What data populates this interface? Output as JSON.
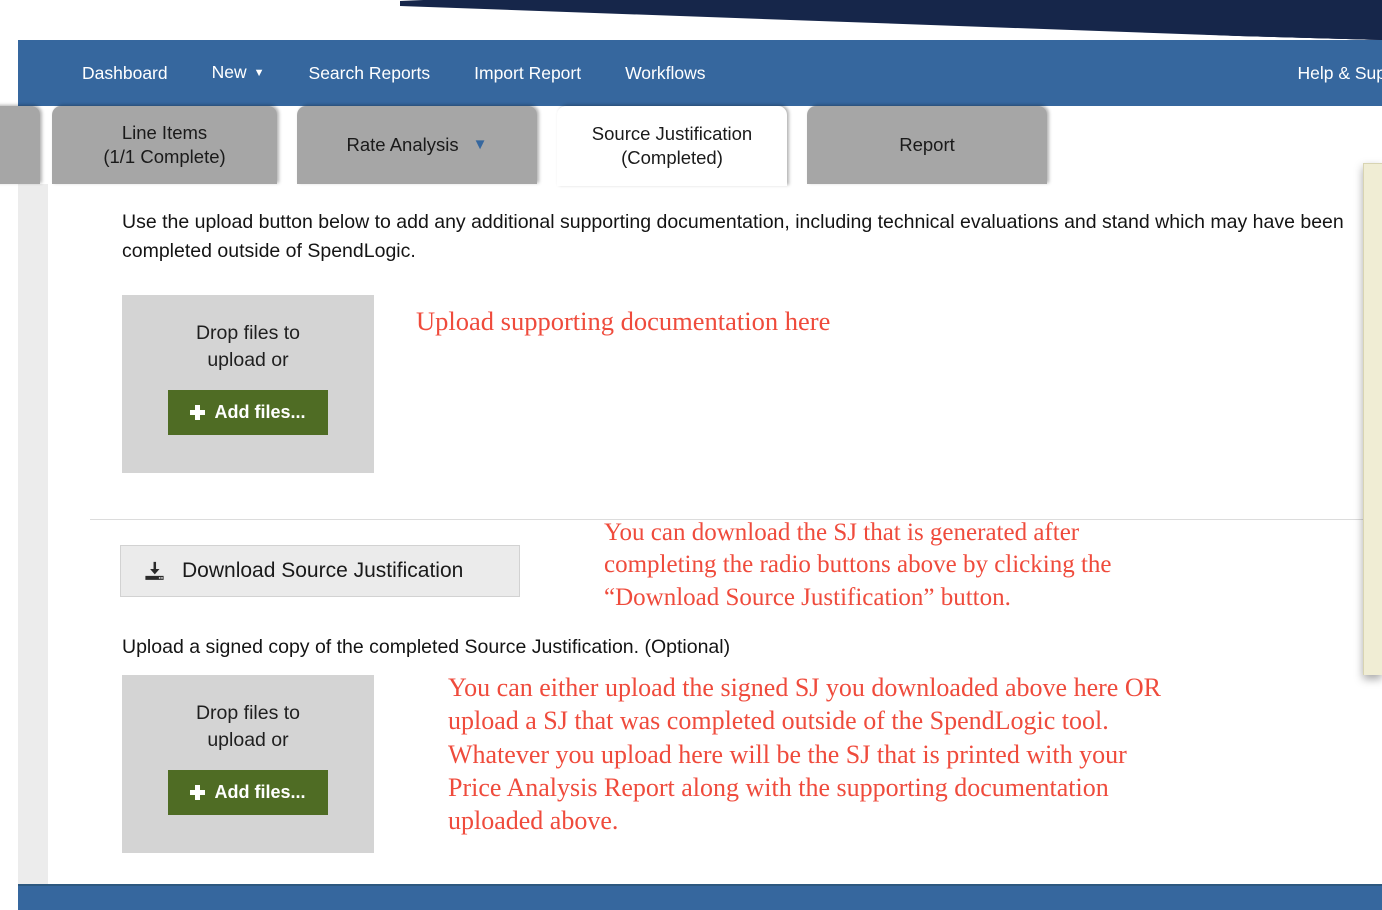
{
  "navbar": {
    "items": [
      {
        "label": "Dashboard",
        "has_caret": false
      },
      {
        "label": "New",
        "has_caret": true
      },
      {
        "label": "Search Reports",
        "has_caret": false
      },
      {
        "label": "Import Report",
        "has_caret": false
      },
      {
        "label": "Workflows",
        "has_caret": false
      }
    ],
    "right_label": "Help & Sup",
    "background_color": "#36679e"
  },
  "tabs": [
    {
      "id": "line-items",
      "label": "Line Items\n(1/1 Complete)",
      "active": false,
      "has_caret": false
    },
    {
      "id": "rate-analysis",
      "label": "Rate Analysis",
      "active": false,
      "has_caret": true
    },
    {
      "id": "source-justification",
      "label": "Source Justification\n(Completed)",
      "active": true,
      "has_caret": false
    },
    {
      "id": "report",
      "label": "Report",
      "active": false,
      "has_caret": false
    }
  ],
  "content": {
    "intro_text": "Use the upload button below to add any additional supporting documentation, including technical evaluations and stand which may have been completed outside of SpendLogic.",
    "dropzone_1": {
      "prompt": "Drop files to upload or",
      "button_label": "Add files..."
    },
    "dropzone_2": {
      "prompt": "Drop files to upload or",
      "button_label": "Add files..."
    },
    "download_button_label": "Download Source Justification",
    "signed_copy_label": "Upload a signed copy of the completed Source Justification. (Optional)",
    "annotation_1": "Upload supporting documentation here",
    "annotation_2": "You can download the SJ that is generated after\ncompleting the radio buttons above by clicking the\n“Download Source Justification” button.",
    "annotation_3": "You can either upload the signed SJ you downloaded above here OR\nupload a SJ that was completed outside of the SpendLogic tool.\nWhatever you upload here will be the SJ that is printed with your\nPrice Analysis Report along with the supporting documentation\nuploaded above.",
    "annotation_color": "#ef4b3c",
    "add_files_button_color": "#4f6c24"
  }
}
